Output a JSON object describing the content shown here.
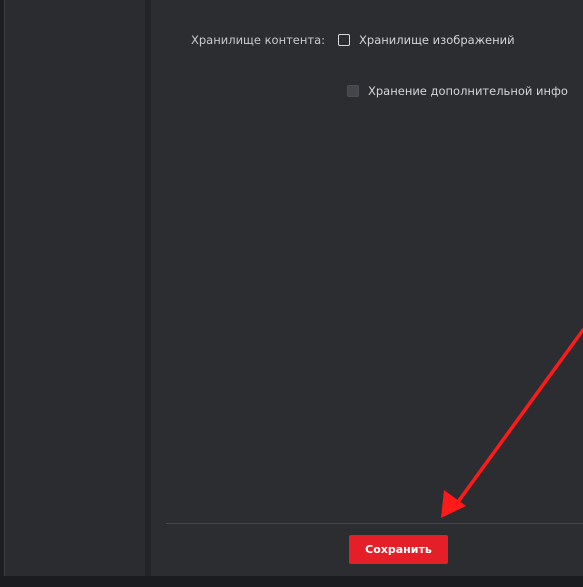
{
  "content_storage": {
    "label": "Хранилище контента:",
    "options": [
      {
        "label": "Хранилище изображений",
        "checked": false,
        "enabled": true
      },
      {
        "label": "Хранение дополнительной инфо",
        "checked": false,
        "enabled": false
      }
    ]
  },
  "footer": {
    "save_label": "Сохранить"
  },
  "colors": {
    "accent": "#e41f27",
    "panel_bg": "#2c2d31",
    "sidebar_bg": "#2b2c30",
    "annotation_arrow": "#ff1a1a"
  },
  "annotation": {
    "type": "arrow",
    "points_to": "save-button"
  }
}
